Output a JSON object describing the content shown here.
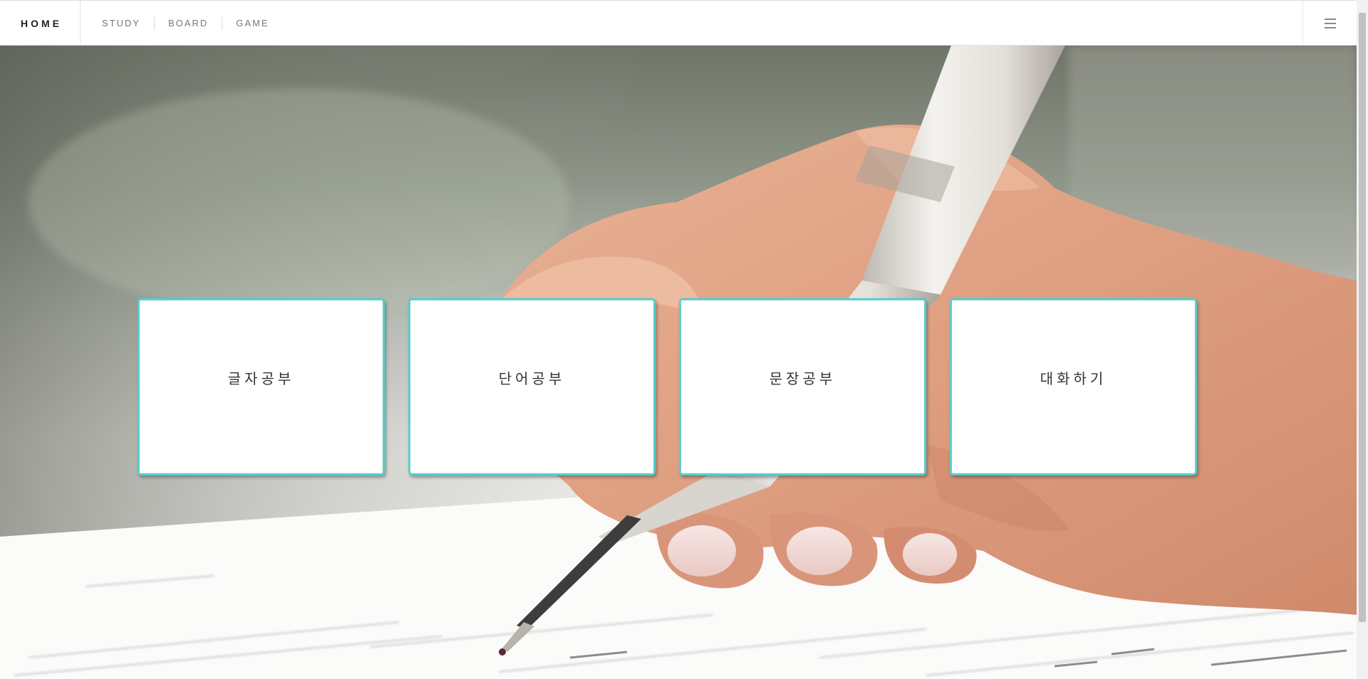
{
  "navbar": {
    "brand": "HOME",
    "links": [
      "STUDY",
      "BOARD",
      "GAME"
    ],
    "menu_icon": "hamburger-icon"
  },
  "hero": {
    "image": "hand-holding-pen-writing-on-document"
  },
  "cards": [
    {
      "label": "글자공부"
    },
    {
      "label": "단어공부"
    },
    {
      "label": "문장공부"
    },
    {
      "label": "대화하기"
    }
  ],
  "colors": {
    "card_border": "#58cfcc",
    "navbar_bg": "#ffffff",
    "nav_text": "#777777",
    "brand_text": "#222222"
  }
}
